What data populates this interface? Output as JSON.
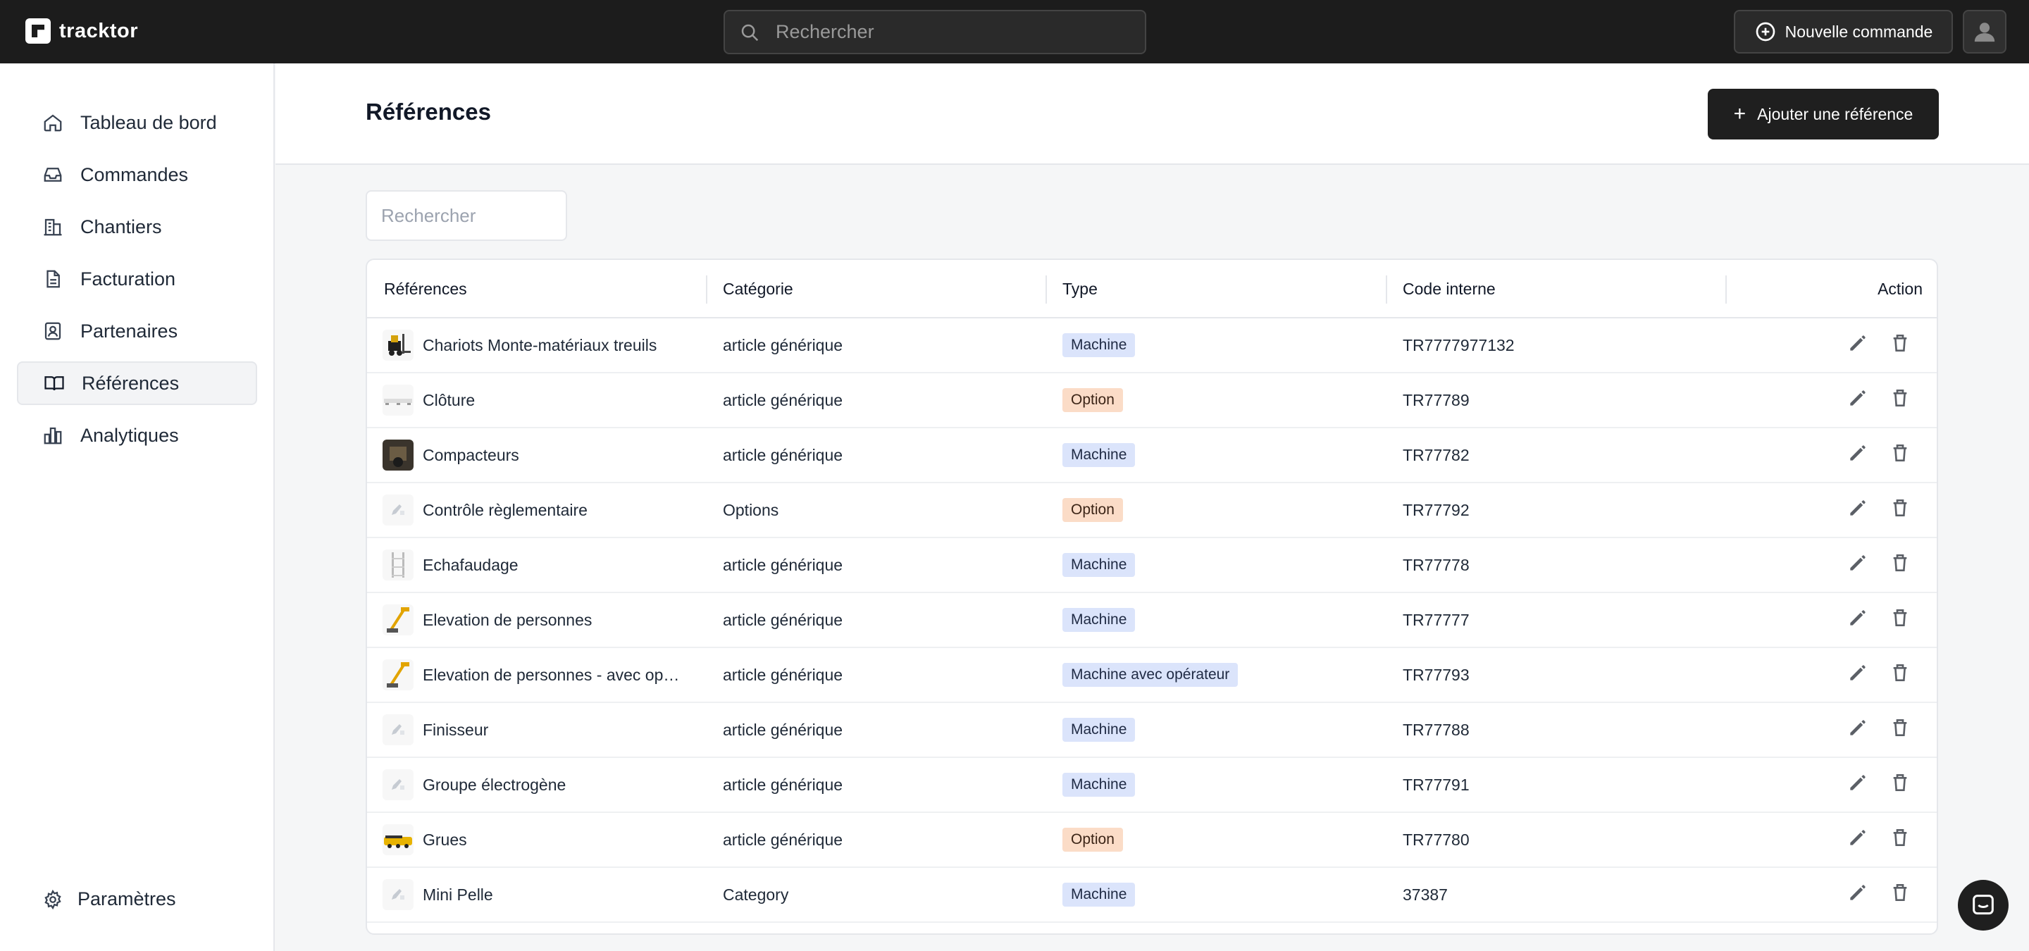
{
  "app": {
    "brand": "tracktor"
  },
  "topbar": {
    "search_placeholder": "Rechercher",
    "new_order_label": "Nouvelle commande"
  },
  "sidebar": {
    "items": [
      {
        "label": "Tableau de bord",
        "icon": "home-icon"
      },
      {
        "label": "Commandes",
        "icon": "inbox-icon"
      },
      {
        "label": "Chantiers",
        "icon": "building-icon"
      },
      {
        "label": "Facturation",
        "icon": "document-icon"
      },
      {
        "label": "Partenaires",
        "icon": "contact-icon"
      },
      {
        "label": "Références",
        "icon": "book-icon",
        "active": true
      },
      {
        "label": "Analytiques",
        "icon": "chart-icon"
      }
    ],
    "settings_label": "Paramètres"
  },
  "page": {
    "title": "Références",
    "add_button_label": "Ajouter une référence",
    "search_placeholder": "Rechercher"
  },
  "table": {
    "columns": [
      "Références",
      "Catégorie",
      "Type",
      "Code interne",
      "Action"
    ],
    "rows": [
      {
        "name": "Chariots Monte-matériaux treuils",
        "category": "article générique",
        "type": "Machine",
        "code": "TR7777977132",
        "thumb": "forklift"
      },
      {
        "name": "Clôture",
        "category": "article générique",
        "type": "Option",
        "code": "TR77789",
        "thumb": "fence"
      },
      {
        "name": "Compacteurs",
        "category": "article générique",
        "type": "Machine",
        "code": "TR77782",
        "thumb": "compactor"
      },
      {
        "name": "Contrôle règlementaire",
        "category": "Options",
        "type": "Option",
        "code": "TR77792",
        "thumb": "placeholder"
      },
      {
        "name": "Echafaudage",
        "category": "article générique",
        "type": "Machine",
        "code": "TR77778",
        "thumb": "scaffold"
      },
      {
        "name": "Elevation de personnes",
        "category": "article générique",
        "type": "Machine",
        "code": "TR77777",
        "thumb": "lift"
      },
      {
        "name": "Elevation de personnes - avec opérateur",
        "category": "article générique",
        "type": "Machine avec opérateur",
        "code": "TR77793",
        "thumb": "lift"
      },
      {
        "name": "Finisseur",
        "category": "article générique",
        "type": "Machine",
        "code": "TR77788",
        "thumb": "placeholder"
      },
      {
        "name": "Groupe électrogène",
        "category": "article générique",
        "type": "Machine",
        "code": "TR77791",
        "thumb": "placeholder"
      },
      {
        "name": "Grues",
        "category": "article générique",
        "type": "Option",
        "code": "TR77780",
        "thumb": "crane"
      },
      {
        "name": "Mini Pelle",
        "category": "Category",
        "type": "Machine",
        "code": "37387",
        "thumb": "placeholder"
      }
    ]
  },
  "colors": {
    "topbar": "#1c1c1c",
    "badge_machine": "#dbe4fb",
    "badge_option": "#fbdcc7"
  }
}
